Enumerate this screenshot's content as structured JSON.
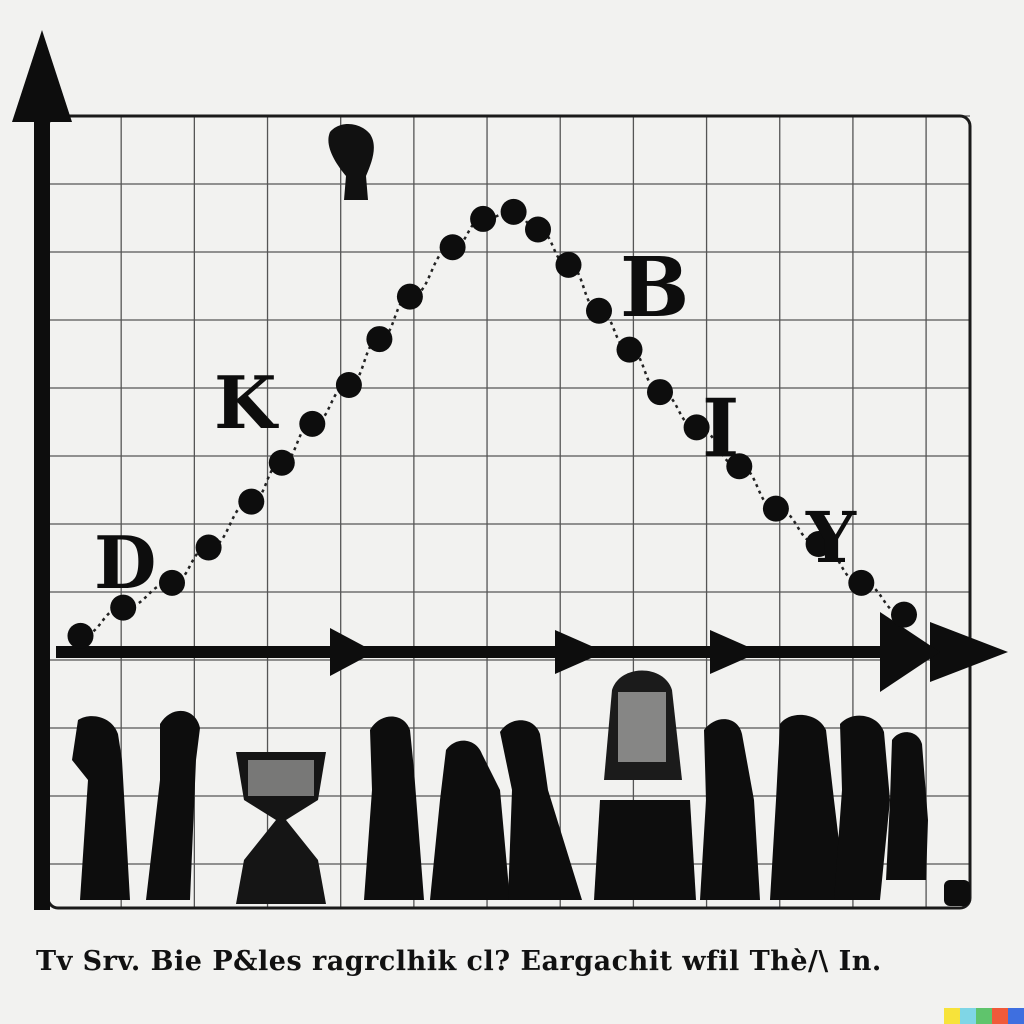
{
  "chart_data": {
    "type": "scatter",
    "title": "",
    "xlabel": "",
    "ylabel": "",
    "grid": true,
    "legend": "none",
    "x": [
      0.5,
      1.2,
      2.0,
      2.6,
      3.3,
      3.8,
      4.3,
      4.9,
      5.4,
      5.9,
      6.6,
      7.1,
      7.6,
      8.0,
      8.5,
      9.0,
      9.5,
      10.0,
      10.6,
      11.3,
      11.9,
      12.6,
      13.3,
      14.0
    ],
    "values": [
      0.4,
      1.2,
      1.9,
      2.9,
      4.2,
      5.3,
      6.4,
      7.5,
      8.8,
      10.0,
      11.4,
      12.2,
      12.4,
      11.9,
      10.9,
      9.6,
      8.5,
      7.3,
      6.3,
      5.2,
      4.0,
      3.0,
      1.9,
      1.0
    ],
    "xlim": [
      0,
      15
    ],
    "ylim": [
      0,
      15
    ],
    "annotations": [
      "D",
      "K",
      "B",
      "I",
      "Y"
    ]
  },
  "caption": "Tv Srv. Bie P&les ragrclhik cl? Eargachit wfil Thè/\\ In.",
  "brand_colors": [
    "#f7e33a",
    "#7fd6e6",
    "#5fc46c",
    "#f05a3a",
    "#3e6fe0"
  ]
}
